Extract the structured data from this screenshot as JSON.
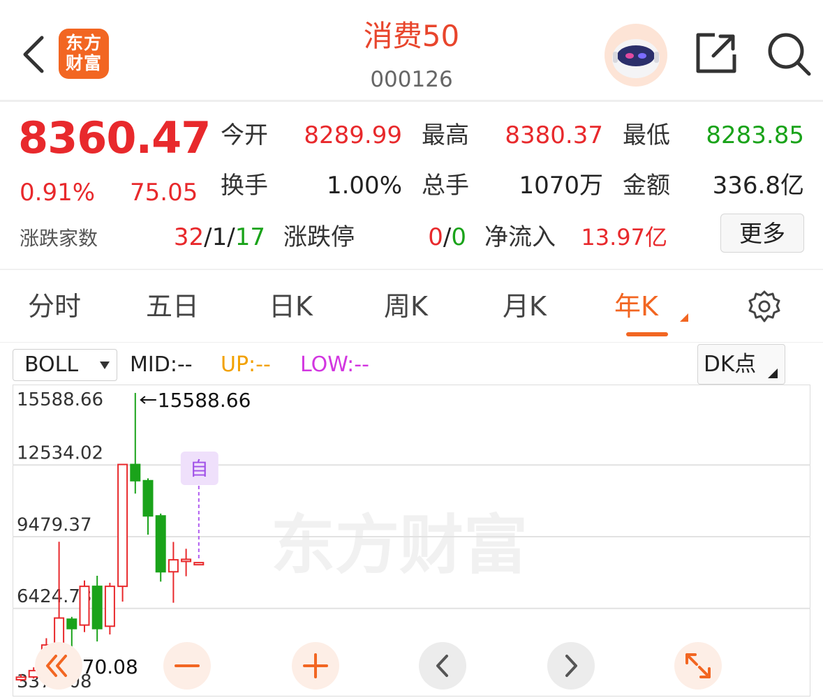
{
  "header": {
    "title": "消费50",
    "code": "000126",
    "logo_line1": "东方",
    "logo_line2": "财富"
  },
  "quote": {
    "price": "8360.47",
    "change_pct": "0.91%",
    "change": "75.05",
    "open_label": "今开",
    "open": "8289.99",
    "high_label": "最高",
    "high": "8380.37",
    "low_label": "最低",
    "low": "8283.85",
    "turnover_label": "换手",
    "turnover": "1.00%",
    "volume_label": "总手",
    "volume": "1070万",
    "amount_label": "金额",
    "amount": "336.8亿",
    "breadth_label": "涨跌家数",
    "breadth_up": "32",
    "breadth_flat": "1",
    "breadth_down": "17",
    "limit_label": "涨跌停",
    "limit_up": "0",
    "limit_down": "0",
    "netflow_label": "净流入",
    "netflow": "13.97亿",
    "more_label": "更多"
  },
  "tabs": [
    {
      "label": "分时"
    },
    {
      "label": "五日"
    },
    {
      "label": "日K"
    },
    {
      "label": "周K"
    },
    {
      "label": "月K"
    },
    {
      "label": "年K"
    }
  ],
  "active_tab": 5,
  "indicator": {
    "select": "BOLL",
    "mid": "MID:--",
    "up": "UP:--",
    "low": "LOW:--",
    "dk_label": "DK点"
  },
  "colors": {
    "up": "#e8292c",
    "down": "#1aa31a",
    "accent": "#f26622",
    "boll_up": "#f2a100",
    "boll_low": "#d236e0"
  },
  "chart_data": {
    "type": "candlestick",
    "y_axis_ticks": [
      "15588.66",
      "12534.02",
      "9479.37",
      "6424.73",
      "3370.08"
    ],
    "ylim": [
      3370.08,
      15588.66
    ],
    "max_label": "15588.66",
    "min_label": "3370.08",
    "watermark": "东方财富",
    "marker_label": "自",
    "candles": [
      {
        "open": 3370,
        "close": 3480,
        "high": 3600,
        "low": 3300
      },
      {
        "open": 3490,
        "close": 3760,
        "high": 3900,
        "low": 3420
      },
      {
        "open": 3800,
        "close": 4850,
        "high": 5140,
        "low": 3700
      },
      {
        "open": 4850,
        "close": 6000,
        "high": 9250,
        "low": 4700
      },
      {
        "open": 5950,
        "close": 5550,
        "high": 6050,
        "low": 4350
      },
      {
        "open": 5700,
        "close": 7350,
        "high": 7600,
        "low": 5400
      },
      {
        "open": 7350,
        "close": 5550,
        "high": 7800,
        "low": 5000
      },
      {
        "open": 5650,
        "close": 7350,
        "high": 7500,
        "low": 5300
      },
      {
        "open": 7350,
        "close": 12540,
        "high": 12540,
        "low": 6700
      },
      {
        "open": 12540,
        "close": 11850,
        "high": 15588.66,
        "low": 11300
      },
      {
        "open": 11850,
        "close": 10350,
        "high": 11950,
        "low": 9550
      },
      {
        "open": 10350,
        "close": 7970,
        "high": 10450,
        "low": 7550
      },
      {
        "open": 7970,
        "close": 8480,
        "high": 9240,
        "low": 6650
      },
      {
        "open": 8480,
        "close": 8500,
        "high": 8950,
        "low": 7780
      },
      {
        "open": 8289.99,
        "close": 8360.47,
        "high": 8380.37,
        "low": 8283.85
      }
    ]
  },
  "controls": [
    {
      "name": "scroll-left-fast"
    },
    {
      "name": "zoom-out"
    },
    {
      "name": "zoom-in"
    },
    {
      "name": "prev"
    },
    {
      "name": "next"
    },
    {
      "name": "fullscreen"
    }
  ]
}
